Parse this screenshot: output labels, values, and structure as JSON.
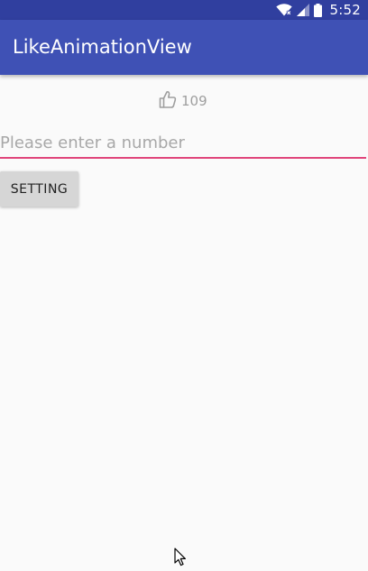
{
  "status_bar": {
    "time": "5:52",
    "icons": [
      "wifi-icon",
      "signal-icon",
      "battery-icon"
    ],
    "background": "#303f9f"
  },
  "app_bar": {
    "title": "LikeAnimationView",
    "background": "#3f51b5"
  },
  "like_view": {
    "icon": "thumbs-up-icon",
    "count": "109"
  },
  "number_input": {
    "value": "",
    "placeholder": "Please enter a number",
    "accent": "#e0457b"
  },
  "setting_button": {
    "label": "SETTING"
  }
}
